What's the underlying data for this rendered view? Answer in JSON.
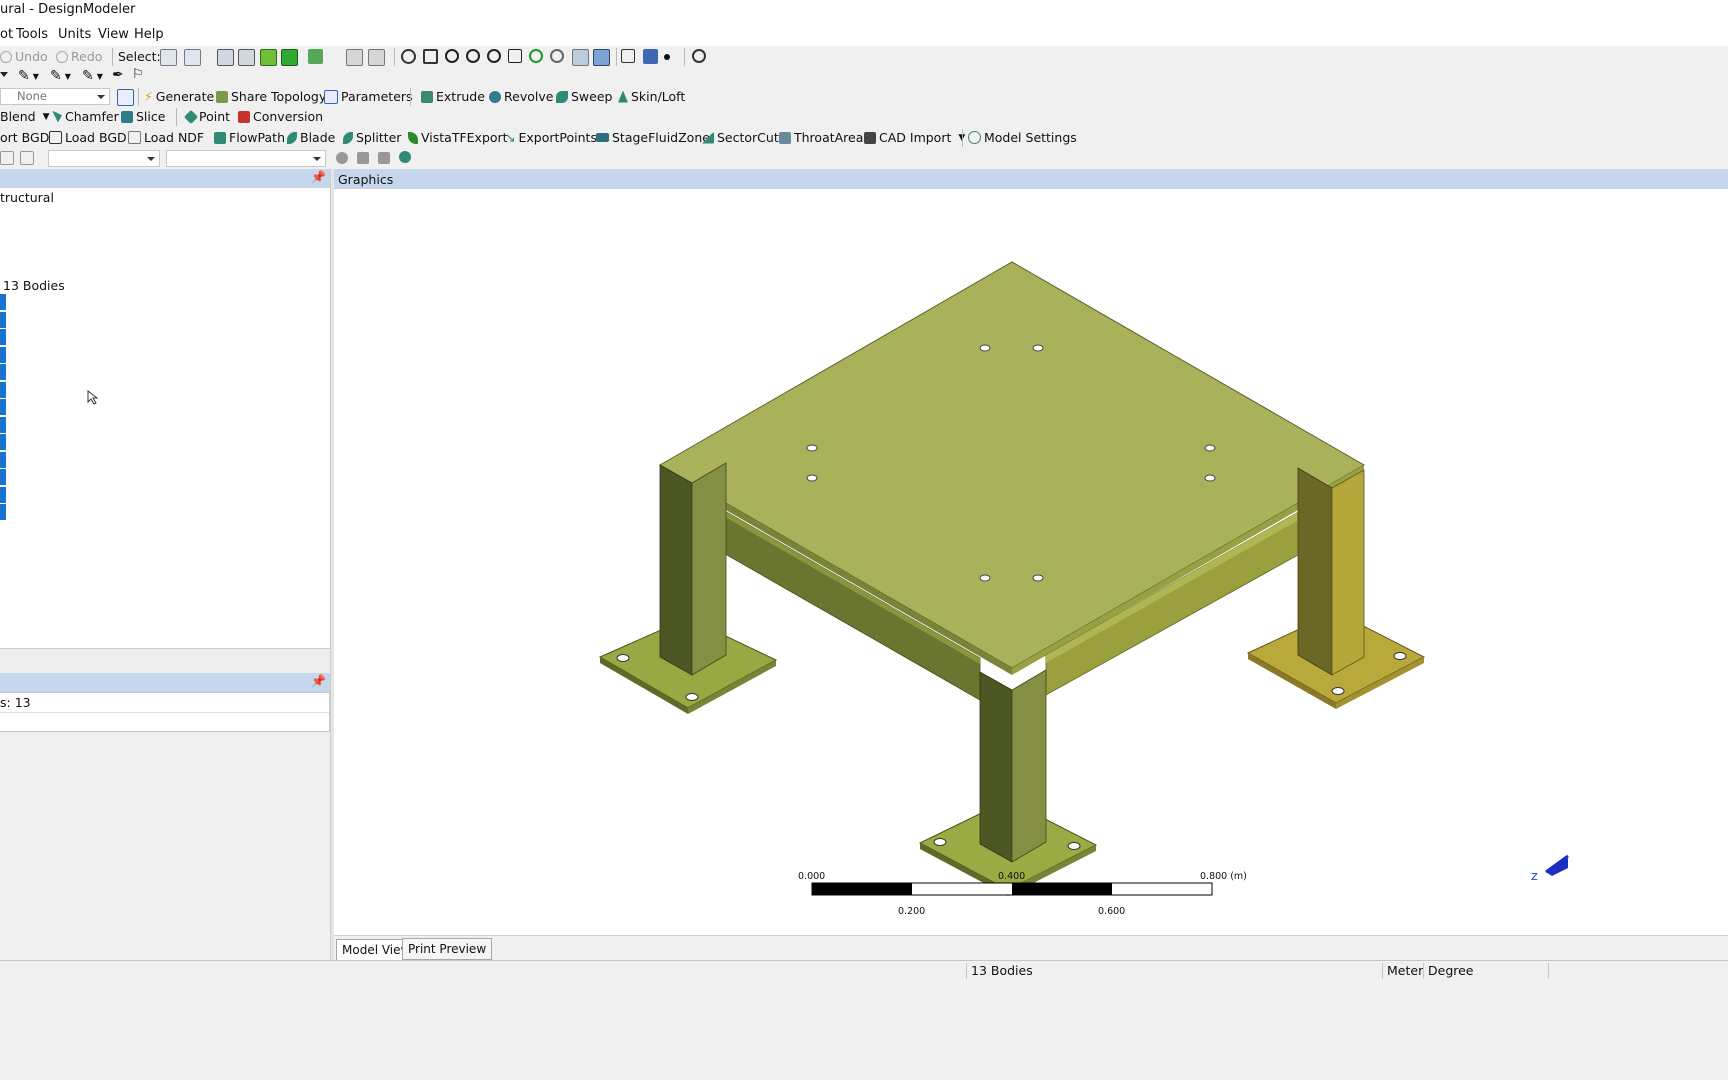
{
  "window": {
    "title": "ural - DesignModeler"
  },
  "menu": [
    "ot",
    "Tools",
    "Units",
    "View",
    "Help"
  ],
  "toolbar1": {
    "undo": "Undo",
    "redo": "Redo",
    "select": "Select:"
  },
  "toolbar3": {
    "plane_combo": "None",
    "generate": "Generate",
    "share_topology": "Share Topology",
    "parameters": "Parameters",
    "extrude": "Extrude",
    "revolve": "Revolve",
    "sweep": "Sweep",
    "skin_loft": "Skin/Loft"
  },
  "toolbar4": {
    "blend": "Blend",
    "chamfer": "Chamfer",
    "slice": "Slice",
    "point": "Point",
    "conversion": "Conversion"
  },
  "toolbar5": {
    "export_bgd": "ort BGD",
    "load_bgd": "Load BGD",
    "load_ndf": "Load NDF",
    "flowpath": "FlowPath",
    "blade": "Blade",
    "splitter": "Splitter",
    "vista": "VistaTFExport",
    "exportpoints": "ExportPoints",
    "stagefluidzone": "StageFluidZone",
    "sectorcut": "SectorCut",
    "throatarea": "ThroatArea",
    "cad_import": "CAD Import",
    "model_settings": "Model Settings"
  },
  "tree": {
    "root": "tructural",
    "bodies": "13 Bodies"
  },
  "details": {
    "row1": "s: 13"
  },
  "graphics": {
    "title": "Graphics",
    "scale": {
      "t0": "0.000",
      "t1": "0.400",
      "t2": "0.800 (m)",
      "b1": "0.200",
      "b2": "0.600"
    },
    "triad_label": "Z"
  },
  "tabs": {
    "model_view": "Model View",
    "print_preview": "Print Preview"
  },
  "status": {
    "selection": "13 Bodies",
    "units_length": "Meter",
    "units_angle": "Degree"
  },
  "colors": {
    "panel_header": "#c6d6ec",
    "tree_highlight": "#1a73d1",
    "model_top": "#a9b25a",
    "model_side_dark": "#5c6a2e",
    "model_side_yellow": "#b7a831"
  }
}
